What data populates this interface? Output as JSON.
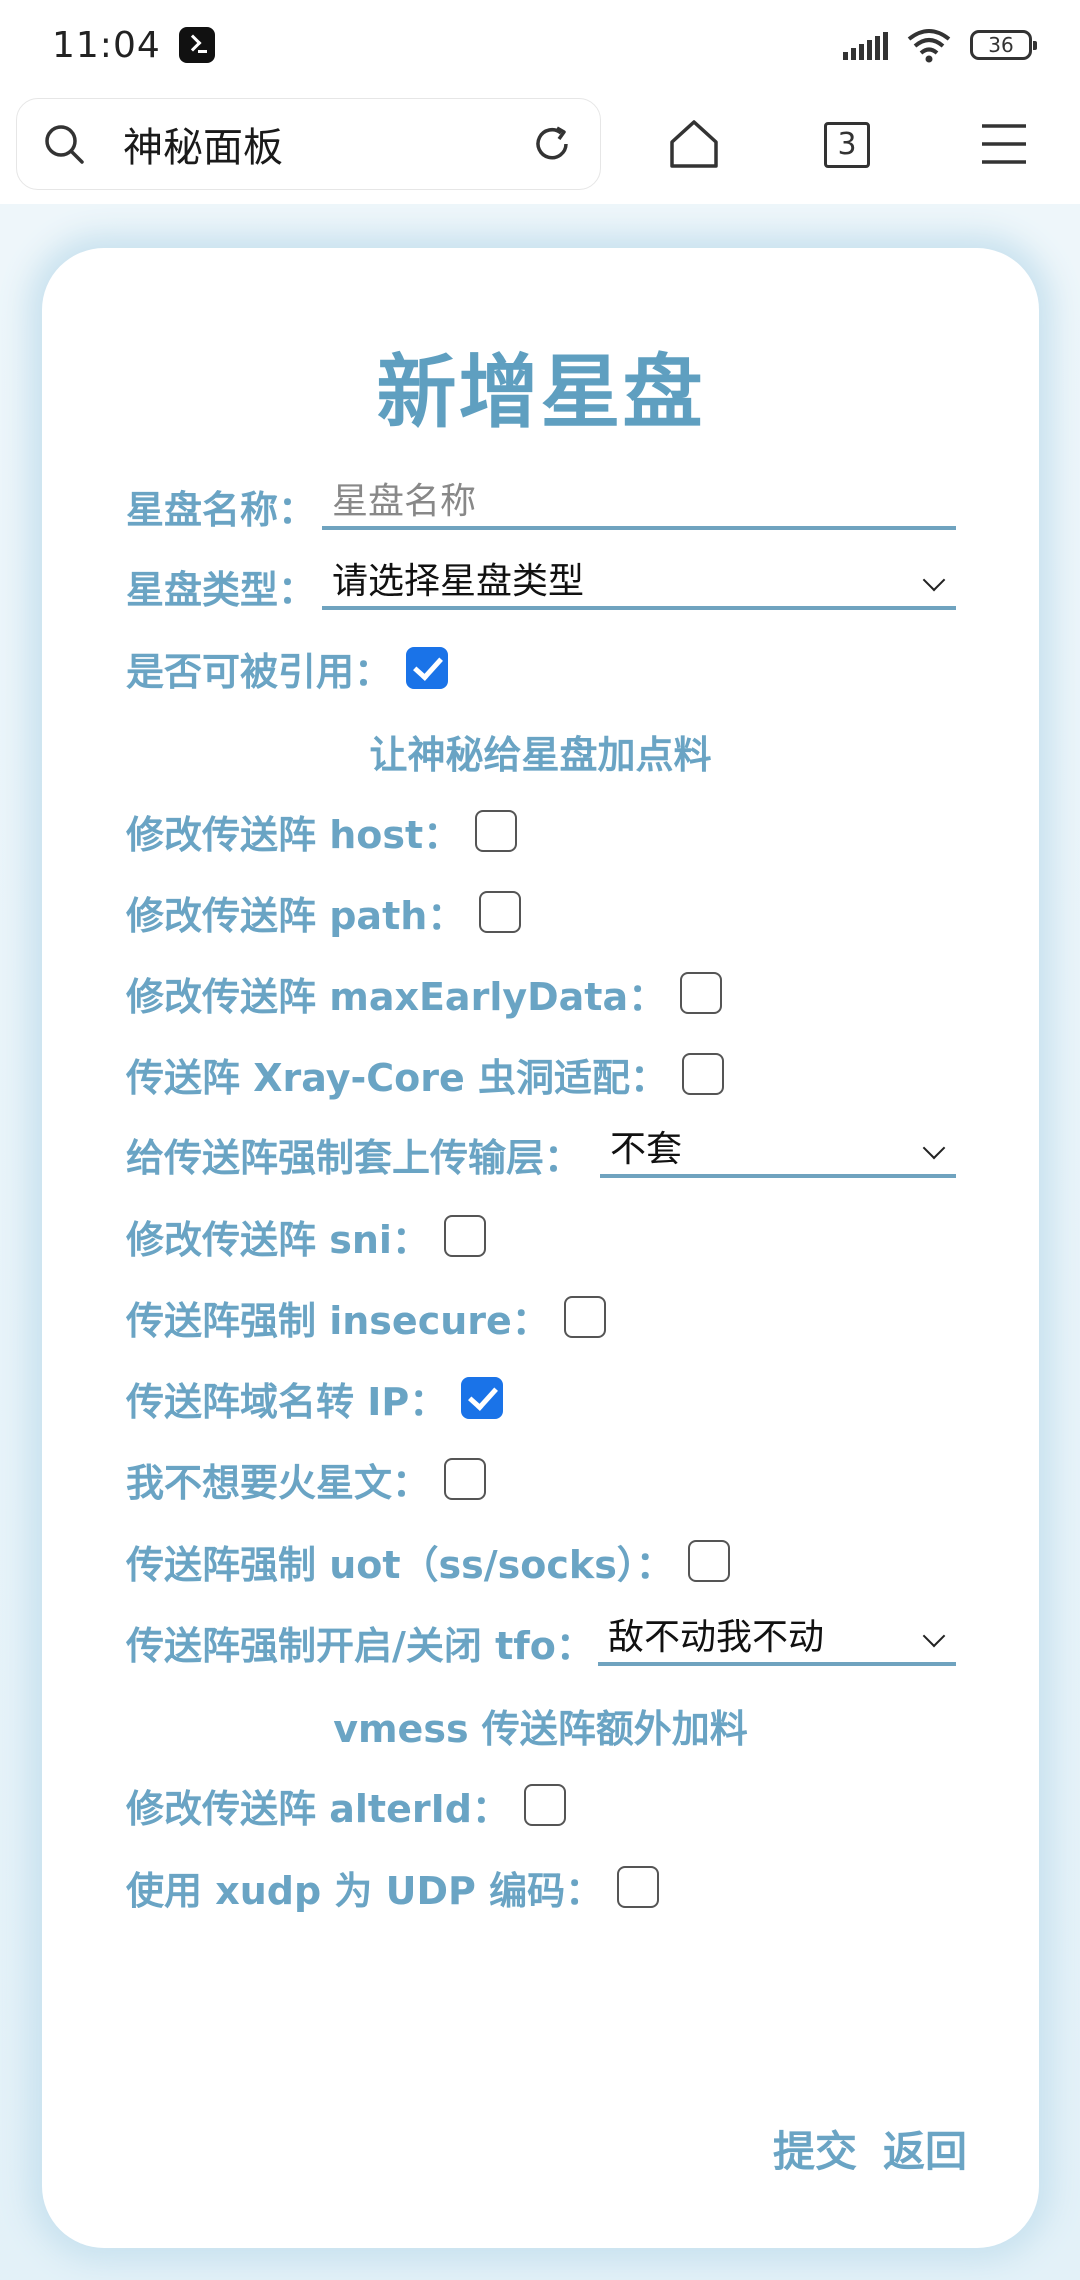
{
  "status": {
    "time": "11:04",
    "battery": "36"
  },
  "browser": {
    "address": "神秘面板",
    "tab_count": "3"
  },
  "form": {
    "title": "新增星盘",
    "name_label": "星盘名称：",
    "name_placeholder": "星盘名称",
    "type_label": "星盘类型：",
    "type_value": "请选择星盘类型",
    "referable_label": "是否可被引用：",
    "referable_checked": true,
    "section1": "让神秘给星盘加点料",
    "host_label": "修改传送阵 host：",
    "path_label": "修改传送阵 path：",
    "maxearly_label": "修改传送阵 maxEarlyData：",
    "xray_label": "传送阵 Xray-Core 虫洞适配：",
    "transport_label": "给传送阵强制套上传输层：",
    "transport_value": "不套",
    "sni_label": "修改传送阵 sni：",
    "insecure_label": "传送阵强制 insecure：",
    "domain_ip_label": "传送阵域名转 IP：",
    "domain_ip_checked": true,
    "no_mars_label": "我不想要火星文：",
    "uot_label": "传送阵强制 uot（ss/socks）：",
    "tfo_label": "传送阵强制开启/关闭 tfo：",
    "tfo_value": "敌不动我不动",
    "section2": "vmess 传送阵额外加料",
    "alterid_label": "修改传送阵 alterId：",
    "xudp_label": "使用 xudp 为 UDP 编码：",
    "submit": "提交",
    "back": "返回"
  },
  "colors": {
    "accent": "#6aa4c4",
    "title": "#5f9fc0",
    "checkbox_checked": "#1a73e8"
  }
}
